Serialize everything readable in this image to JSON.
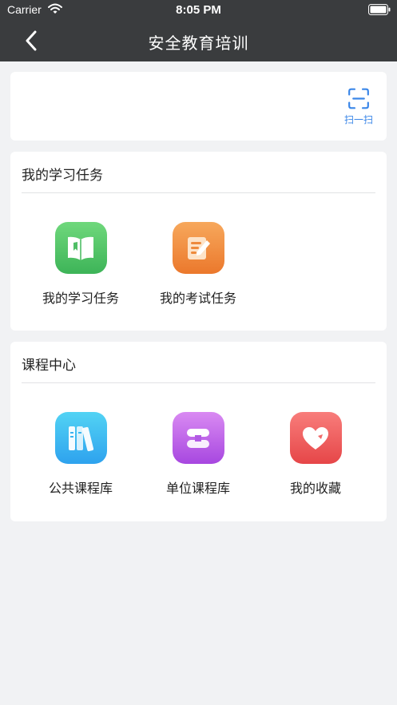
{
  "status_bar": {
    "carrier": "Carrier",
    "time": "8:05 PM"
  },
  "nav": {
    "title": "安全教育培训",
    "back_icon": "chevron-left-icon"
  },
  "scan": {
    "label": "扫一扫",
    "icon": "scan-icon",
    "color": "#3a86e8"
  },
  "sections": [
    {
      "title": "我的学习任务",
      "items": [
        {
          "label": "我的学习任务",
          "icon": "open-book-icon",
          "colors": [
            "#6dd879",
            "#3fb85a"
          ]
        },
        {
          "label": "我的考试任务",
          "icon": "exam-edit-icon",
          "colors": [
            "#f7a65a",
            "#ec7a2d"
          ]
        }
      ]
    },
    {
      "title": "课程中心",
      "items": [
        {
          "label": "公共课程库",
          "icon": "books-icon",
          "colors": [
            "#4fd0f3",
            "#2fa6ee"
          ]
        },
        {
          "label": "单位课程库",
          "icon": "course-stack-icon",
          "colors": [
            "#d57cf0",
            "#a64be0"
          ]
        },
        {
          "label": "我的收藏",
          "icon": "heart-icon",
          "colors": [
            "#f77a78",
            "#e8484a"
          ]
        }
      ]
    }
  ]
}
